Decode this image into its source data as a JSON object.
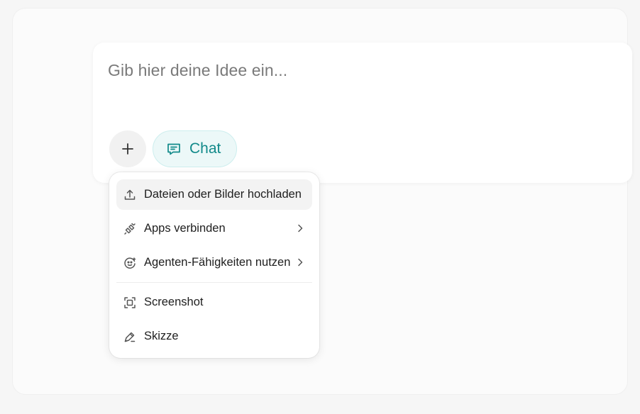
{
  "composer": {
    "placeholder": "Gib hier deine Idee ein...",
    "chat_label": "Chat"
  },
  "menu": {
    "items": [
      {
        "label": "Dateien oder Bilder hochladen",
        "icon": "upload-icon"
      },
      {
        "label": "Apps verbinden",
        "icon": "plug-icon",
        "has_submenu": true
      },
      {
        "label": "Agenten-Fähigkeiten nutzen",
        "icon": "agent-skills-icon",
        "has_submenu": true
      },
      {
        "label": "Screenshot",
        "icon": "screenshot-icon"
      },
      {
        "label": "Skizze",
        "icon": "pen-icon"
      }
    ]
  },
  "colors": {
    "accent": "#128a8a",
    "accent_bg": "#ecf8f8",
    "hover_bg": "#f3f3f3"
  }
}
